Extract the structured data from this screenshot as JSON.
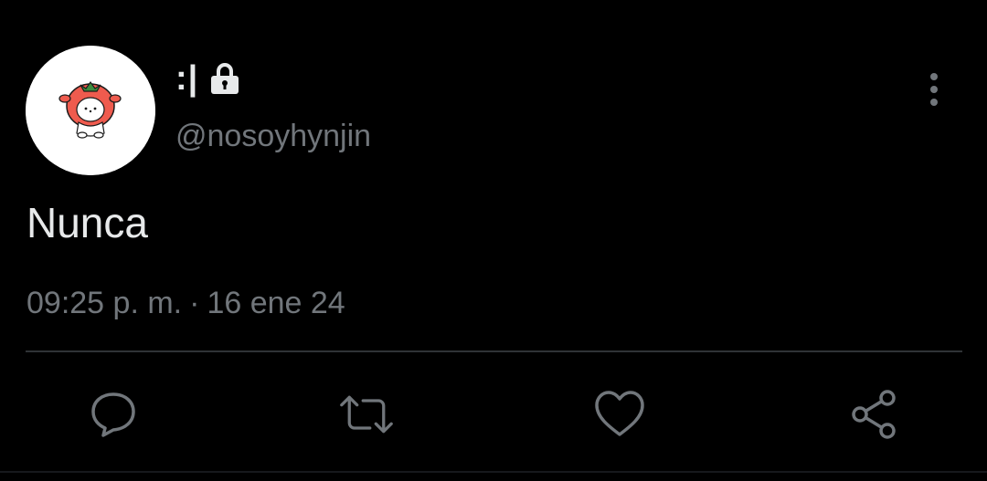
{
  "tweet": {
    "display_name": ":|",
    "handle": "@nosoyhynjin",
    "text": "Nunca",
    "time": "09:25 p. m.",
    "separator": "·",
    "date": "16 ene 24"
  },
  "icons": {
    "lock": "lock-icon",
    "more": "more-vertical-icon",
    "reply": "reply-icon",
    "retweet": "retweet-icon",
    "like": "heart-icon",
    "share": "share-icon"
  },
  "colors": {
    "background": "#000000",
    "primary_text": "#e7e9ea",
    "secondary_text": "#71767b",
    "divider": "#2f3336",
    "avatar_bg": "#ffffff",
    "avatar_tomato": "#ef5b4e"
  }
}
